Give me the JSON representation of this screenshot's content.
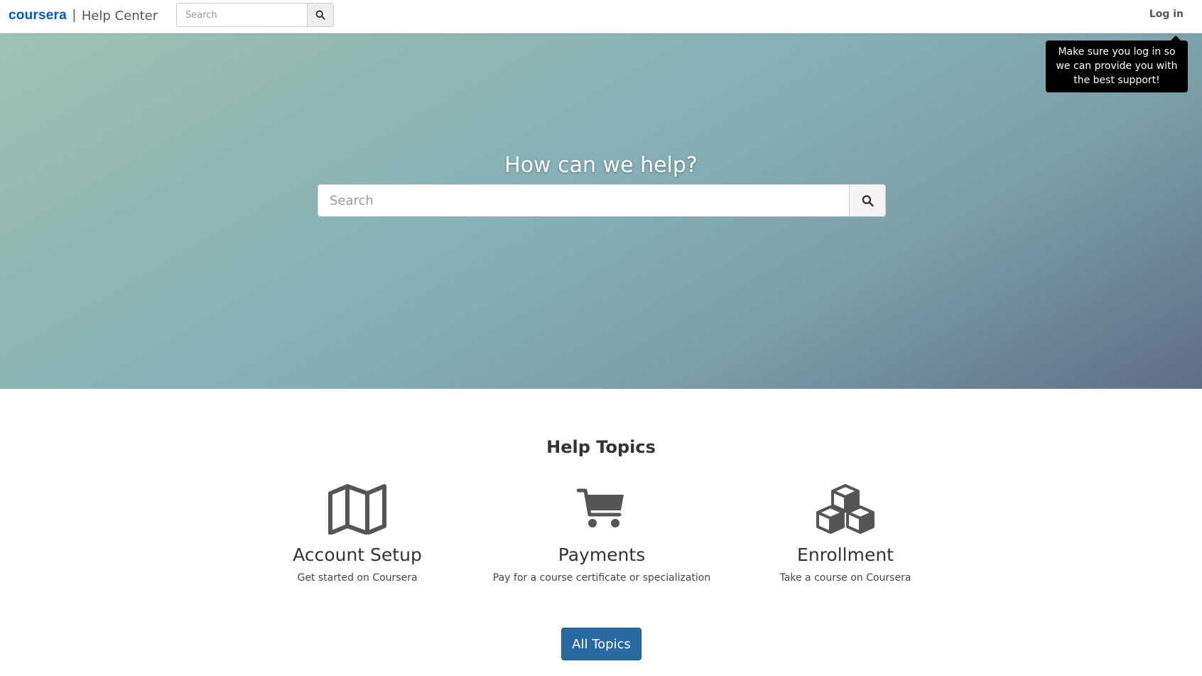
{
  "header": {
    "logo": "coursera",
    "separator": "|",
    "title": "Help Center",
    "search_placeholder": "Search",
    "login_label": "Log in"
  },
  "tooltip": {
    "text": "Make sure you log in so we can provide you with the best support!"
  },
  "hero": {
    "title": "How can we help?",
    "search_placeholder": "Search"
  },
  "topics": {
    "heading": "Help Topics",
    "items": [
      {
        "icon": "map-icon",
        "title": "Account Setup",
        "description": "Get started on Coursera"
      },
      {
        "icon": "cart-icon",
        "title": "Payments",
        "description": "Pay for a course certificate or specialization"
      },
      {
        "icon": "cubes-icon",
        "title": "Enrollment",
        "description": "Take a course on Coursera"
      }
    ],
    "all_label": "All Topics"
  },
  "colors": {
    "brand": "#0056d2",
    "button": "#2a6aa2",
    "icon": "#555555"
  }
}
